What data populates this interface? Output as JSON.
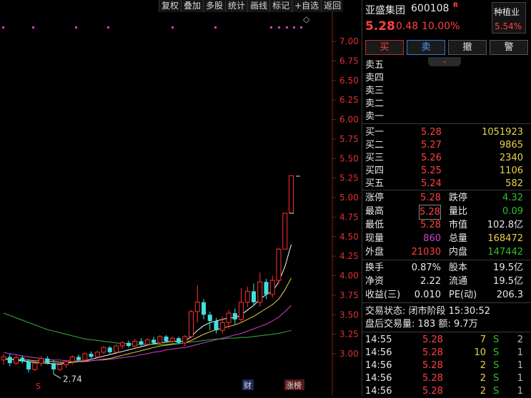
{
  "toolbar": [
    "复权",
    "叠加",
    "多股",
    "统计",
    "画线",
    "标记",
    "+自选",
    "返回"
  ],
  "chart_data": {
    "type": "candlestick",
    "ylim": [
      2.7,
      7.1
    ],
    "y_ticks": [
      "7.00",
      "6.75",
      "6.50",
      "6.25",
      "6.00",
      "5.75",
      "5.50",
      "5.25",
      "5.00",
      "4.75",
      "4.50",
      "4.25",
      "4.00",
      "3.75",
      "3.50",
      "3.25",
      "3.00"
    ],
    "low_annotation": "2.74",
    "candles": [
      [
        2.92,
        2.96,
        2.86,
        3.0
      ],
      [
        2.96,
        2.88,
        2.84,
        3.0
      ],
      [
        2.88,
        2.95,
        2.86,
        2.98
      ],
      [
        2.95,
        2.9,
        2.87,
        2.98
      ],
      [
        2.9,
        2.8,
        2.76,
        2.93
      ],
      [
        2.8,
        2.88,
        2.78,
        2.9
      ],
      [
        2.88,
        2.94,
        2.84,
        2.97
      ],
      [
        2.94,
        2.88,
        2.86,
        2.97
      ],
      [
        2.88,
        2.8,
        2.74,
        2.92
      ],
      [
        2.8,
        2.86,
        2.78,
        2.88
      ],
      [
        2.86,
        2.9,
        2.82,
        2.92
      ],
      [
        2.9,
        2.96,
        2.86,
        2.98
      ],
      [
        2.96,
        2.92,
        2.9,
        2.99
      ],
      [
        2.92,
        3.0,
        2.9,
        3.02
      ],
      [
        3.0,
        2.96,
        2.94,
        3.03
      ],
      [
        2.96,
        3.02,
        2.94,
        3.04
      ],
      [
        3.02,
        3.08,
        3.0,
        3.1
      ],
      [
        3.08,
        3.02,
        3.0,
        3.1
      ],
      [
        3.02,
        3.1,
        3.0,
        3.12
      ],
      [
        3.1,
        3.14,
        3.06,
        3.16
      ],
      [
        3.14,
        3.1,
        3.08,
        3.17
      ],
      [
        3.1,
        3.16,
        3.08,
        3.19
      ],
      [
        3.16,
        3.12,
        3.1,
        3.2
      ],
      [
        3.12,
        3.18,
        3.1,
        3.2
      ],
      [
        3.18,
        3.14,
        3.12,
        3.22
      ],
      [
        3.14,
        3.22,
        3.12,
        3.24
      ],
      [
        3.22,
        3.16,
        3.14,
        3.24
      ],
      [
        3.16,
        3.2,
        3.14,
        3.22
      ],
      [
        3.2,
        3.14,
        3.12,
        3.22
      ],
      [
        3.14,
        3.22,
        3.1,
        3.24
      ],
      [
        3.22,
        3.54,
        3.2,
        3.56
      ],
      [
        3.54,
        3.66,
        3.4,
        3.88
      ],
      [
        3.66,
        3.5,
        3.44,
        3.7
      ],
      [
        3.5,
        3.42,
        3.3,
        3.54
      ],
      [
        3.42,
        3.3,
        3.26,
        3.46
      ],
      [
        3.3,
        3.4,
        3.26,
        3.48
      ],
      [
        3.4,
        3.52,
        3.32,
        3.56
      ],
      [
        3.52,
        3.44,
        3.38,
        3.58
      ],
      [
        3.44,
        3.66,
        3.4,
        3.84
      ],
      [
        3.66,
        3.8,
        3.6,
        3.86
      ],
      [
        3.8,
        3.66,
        3.62,
        3.9
      ],
      [
        3.66,
        3.92,
        3.6,
        4.04
      ],
      [
        3.92,
        3.76,
        3.7,
        3.96
      ],
      [
        3.76,
        3.94,
        3.72,
        4.0
      ],
      [
        3.94,
        4.34,
        3.9,
        4.36
      ],
      [
        4.34,
        4.8,
        4.34,
        4.8
      ],
      [
        4.8,
        5.28,
        5.28,
        5.28
      ]
    ],
    "ma_series": [
      {
        "color": "#ffffff",
        "values": [
          2.93,
          2.93,
          2.92,
          2.91,
          2.9,
          2.89,
          2.88,
          2.88,
          2.87,
          2.87,
          2.88,
          2.89,
          2.9,
          2.91,
          2.93,
          2.95,
          2.97,
          2.99,
          3.01,
          3.03,
          3.05,
          3.07,
          3.09,
          3.11,
          3.13,
          3.14,
          3.15,
          3.16,
          3.16,
          3.16,
          3.22,
          3.3,
          3.36,
          3.4,
          3.42,
          3.44,
          3.46,
          3.46,
          3.5,
          3.56,
          3.62,
          3.7,
          3.76,
          3.8,
          3.92,
          4.12,
          4.4
        ]
      },
      {
        "color": "#e8d24a",
        "values": [
          2.94,
          2.93,
          2.93,
          2.92,
          2.92,
          2.91,
          2.91,
          2.9,
          2.9,
          2.89,
          2.89,
          2.89,
          2.9,
          2.9,
          2.91,
          2.92,
          2.93,
          2.94,
          2.96,
          2.98,
          3.0,
          3.02,
          3.04,
          3.06,
          3.08,
          3.1,
          3.11,
          3.12,
          3.13,
          3.14,
          3.17,
          3.21,
          3.25,
          3.28,
          3.31,
          3.33,
          3.35,
          3.37,
          3.4,
          3.44,
          3.48,
          3.53,
          3.58,
          3.63,
          3.7,
          3.82,
          3.97
        ]
      },
      {
        "color": "#d040d0",
        "values": [
          3.02,
          3.0,
          2.99,
          2.97,
          2.96,
          2.95,
          2.94,
          2.93,
          2.92,
          2.92,
          2.91,
          2.91,
          2.91,
          2.91,
          2.91,
          2.92,
          2.92,
          2.93,
          2.94,
          2.95,
          2.96,
          2.97,
          2.99,
          3.0,
          3.02,
          3.03,
          3.05,
          3.06,
          3.07,
          3.08,
          3.1,
          3.12,
          3.14,
          3.16,
          3.18,
          3.2,
          3.22,
          3.24,
          3.26,
          3.29,
          3.32,
          3.35,
          3.38,
          3.42,
          3.47,
          3.54,
          3.62
        ]
      },
      {
        "color": "#3ab03a",
        "values": [
          3.52,
          3.49,
          3.46,
          3.43,
          3.4,
          3.37,
          3.34,
          3.31,
          3.29,
          3.27,
          3.25,
          3.23,
          3.21,
          3.19,
          3.18,
          3.17,
          3.16,
          3.15,
          3.14,
          3.13,
          3.13,
          3.12,
          3.12,
          3.12,
          3.12,
          3.12,
          3.12,
          3.13,
          3.13,
          3.14,
          3.15,
          3.16,
          3.17,
          3.18,
          3.19,
          3.19,
          3.2,
          3.2,
          3.21,
          3.21,
          3.22,
          3.23,
          3.24,
          3.25,
          3.26,
          3.28,
          3.3
        ]
      }
    ],
    "markers": {
      "s_label": "S",
      "cai_label": "财",
      "zhangbang_label": "涨榜"
    }
  },
  "stock": {
    "name": "亚盛集团",
    "code": "600108",
    "r_tag": "R",
    "price": "5.28",
    "change": "0.48",
    "pct": "10.00%",
    "sector": "种植业",
    "sector_pct": "5.54%"
  },
  "trade_buttons": [
    "买",
    "卖",
    "撤",
    "警"
  ],
  "sell_labels": [
    "卖五",
    "卖四",
    "卖三",
    "卖二",
    "卖一"
  ],
  "buy_rows": [
    {
      "label": "买一",
      "price": "5.28",
      "vol": "1051923"
    },
    {
      "label": "买二",
      "price": "5.27",
      "vol": "9865"
    },
    {
      "label": "买三",
      "price": "5.26",
      "vol": "2340"
    },
    {
      "label": "买四",
      "price": "5.25",
      "vol": "1106"
    },
    {
      "label": "买五",
      "price": "5.24",
      "vol": "582"
    }
  ],
  "stats": [
    {
      "l1": "涨停",
      "v1": "5.28",
      "c1": "red",
      "l2": "跌停",
      "v2": "4.32",
      "c2": "green"
    },
    {
      "l1": "最高",
      "v1": "5.28",
      "c1": "red",
      "l2": "量比",
      "v2": "0.09",
      "c2": "green"
    },
    {
      "l1": "最低",
      "v1": "5.28",
      "c1": "red",
      "l2": "市值",
      "v2": "102.8亿",
      "c2": "white"
    },
    {
      "l1": "现量",
      "v1": "860",
      "c1": "purple",
      "l2": "总量",
      "v2": "168472",
      "c2": "yellow"
    },
    {
      "l1": "外盘",
      "v1": "21030",
      "c1": "red",
      "l2": "内盘",
      "v2": "147442",
      "c2": "green"
    }
  ],
  "stats2": [
    {
      "l1": "换手",
      "v1": "0.87%",
      "l2": "股本",
      "v2": "19.5亿"
    },
    {
      "l1": "净资",
      "v1": "2.22",
      "l2": "流通",
      "v2": "19.5亿"
    },
    {
      "l1": "收益(三)",
      "v1": "0.010",
      "l2": "PE(动)",
      "v2": "206.3"
    }
  ],
  "status_line": "交易状态: 闭市阶段 15:30:52",
  "after_line": "盘后交易量: 183  额: 9.7万",
  "ticks": [
    {
      "time": "14:55",
      "price": "5.28",
      "vol": "7",
      "side": "S",
      "n": "2"
    },
    {
      "time": "14:56",
      "price": "5.28",
      "vol": "10",
      "side": "S",
      "n": "1"
    },
    {
      "time": "14:56",
      "price": "5.28",
      "vol": "2",
      "side": "S",
      "n": "1"
    },
    {
      "time": "14:56",
      "price": "5.28",
      "vol": "2",
      "side": "S",
      "n": "1"
    },
    {
      "time": "14:56",
      "price": "5.28",
      "vol": "2",
      "side": "S",
      "n": "1"
    }
  ]
}
